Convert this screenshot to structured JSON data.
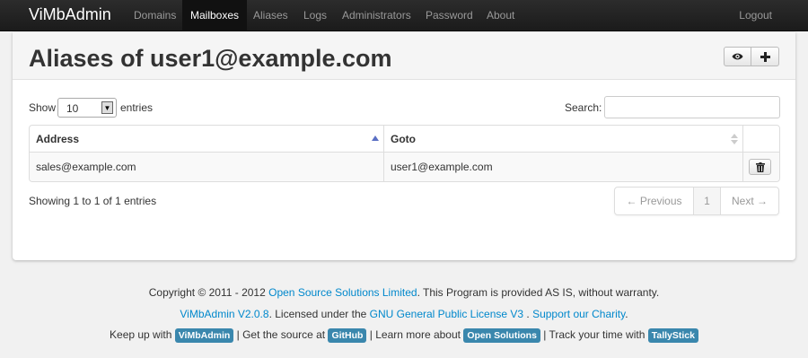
{
  "navbar": {
    "brand": "ViMbAdmin",
    "items": [
      {
        "label": "Domains"
      },
      {
        "label": "Mailboxes"
      },
      {
        "label": "Aliases"
      },
      {
        "label": "Logs"
      },
      {
        "label": "Administrators"
      },
      {
        "label": "Password"
      },
      {
        "label": "About"
      }
    ],
    "active": "Mailboxes",
    "logout": "Logout"
  },
  "page": {
    "title": "Aliases of user1@example.com",
    "actions": [
      {
        "icon": "eye-icon"
      },
      {
        "icon": "plus-icon"
      }
    ]
  },
  "table_controls": {
    "show_label": "Show",
    "page_length": "10",
    "entries_label": "entries",
    "search_label": "Search:",
    "search_value": ""
  },
  "table": {
    "columns": [
      {
        "label": "Address",
        "sort": "ascending"
      },
      {
        "label": "Goto",
        "sort": "none"
      },
      {
        "label": ""
      }
    ],
    "rows": [
      {
        "address": "sales@example.com",
        "goto": "user1@example.com",
        "action_icon": "trash-icon"
      }
    ]
  },
  "pagination": {
    "info": "Showing 1 to 1 of 1 entries",
    "previous": "← Previous",
    "current_page": "1",
    "next": "Next →"
  },
  "footer": {
    "line1_prefix": "Copyright © 2011 - 2012 ",
    "line1_link": "Open Source Solutions Limited",
    "line1_suffix": ". This Program is provided AS IS, without warranty.",
    "line2_link1": "ViMbAdmin V2.0.8",
    "line2_text1": ". Licensed under the ",
    "line2_link2": "GNU General Public License V3",
    "line2_text2": " . ",
    "line2_link3": "Support our Charity",
    "line2_text3": ".",
    "line3_text1": "Keep up with ",
    "line3_badge1": "ViMbAdmin",
    "line3_text2": " | Get the source at ",
    "line3_badge2": "GitHub",
    "line3_text3": " | Learn more about ",
    "line3_badge3": "Open Solutions",
    "line3_text4": " | Track your time with ",
    "line3_badge4": "TallyStick"
  },
  "colors": {
    "navbar_bg": "#1b1b1b",
    "link": "#0088cc",
    "badge": "#3a87ad",
    "page_bg": "#f1f1f1"
  }
}
